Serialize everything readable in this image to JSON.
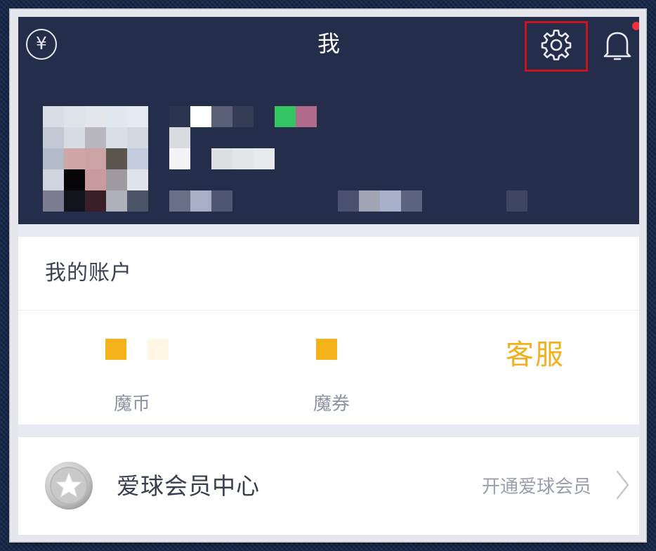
{
  "window": {
    "title": "我"
  },
  "header": {
    "wallet_icon": "yen-circle-icon",
    "settings_icon": "gear-icon",
    "notifications_icon": "bell-icon",
    "notification_dot_color": "#f0303a",
    "settings_highlight_color": "#c9141d",
    "background_color": "#242d4a"
  },
  "account": {
    "section_title": "我的账户",
    "stats": [
      {
        "label": "魔币"
      },
      {
        "label": "魔券"
      }
    ],
    "service_label": "客服",
    "accent_color": "#f2b01e"
  },
  "membership": {
    "title": "爱球会员中心",
    "action_label": "开通爱球会员",
    "badge_icon": "star-badge-icon",
    "chevron_icon": "chevron-right-icon"
  }
}
